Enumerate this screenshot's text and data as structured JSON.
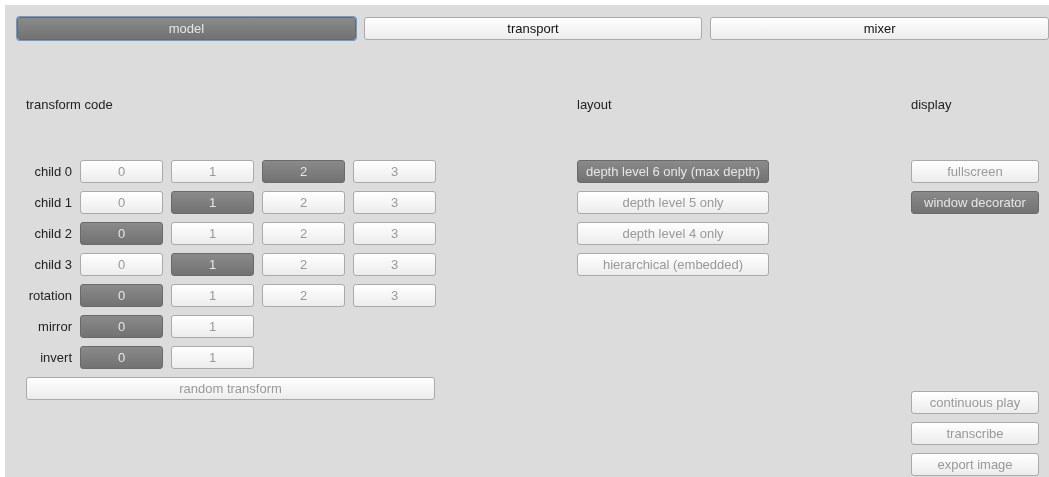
{
  "tabs": [
    {
      "label": "model",
      "selected": true
    },
    {
      "label": "transport",
      "selected": false
    },
    {
      "label": "mixer",
      "selected": false
    }
  ],
  "transform_code": {
    "title": "transform code",
    "rows": [
      {
        "label": "child 0",
        "options": [
          {
            "label": "0",
            "selected": false
          },
          {
            "label": "1",
            "selected": false
          },
          {
            "label": "2",
            "selected": true
          },
          {
            "label": "3",
            "selected": false
          }
        ]
      },
      {
        "label": "child 1",
        "options": [
          {
            "label": "0",
            "selected": false
          },
          {
            "label": "1",
            "selected": true
          },
          {
            "label": "2",
            "selected": false
          },
          {
            "label": "3",
            "selected": false
          }
        ]
      },
      {
        "label": "child 2",
        "options": [
          {
            "label": "0",
            "selected": true
          },
          {
            "label": "1",
            "selected": false
          },
          {
            "label": "2",
            "selected": false
          },
          {
            "label": "3",
            "selected": false
          }
        ]
      },
      {
        "label": "child 3",
        "options": [
          {
            "label": "0",
            "selected": false
          },
          {
            "label": "1",
            "selected": true
          },
          {
            "label": "2",
            "selected": false
          },
          {
            "label": "3",
            "selected": false
          }
        ]
      },
      {
        "label": "rotation",
        "options": [
          {
            "label": "0",
            "selected": true
          },
          {
            "label": "1",
            "selected": false
          },
          {
            "label": "2",
            "selected": false
          },
          {
            "label": "3",
            "selected": false
          }
        ]
      },
      {
        "label": "mirror",
        "options": [
          {
            "label": "0",
            "selected": true
          },
          {
            "label": "1",
            "selected": false
          }
        ]
      },
      {
        "label": "invert",
        "options": [
          {
            "label": "0",
            "selected": true
          },
          {
            "label": "1",
            "selected": false
          }
        ]
      }
    ],
    "random_button": "random transform"
  },
  "layout": {
    "title": "layout",
    "options": [
      {
        "label": "depth level 6 only (max depth)",
        "selected": true
      },
      {
        "label": "depth level 5 only",
        "selected": false
      },
      {
        "label": "depth level 4 only",
        "selected": false
      },
      {
        "label": "hierarchical (embedded)",
        "selected": false
      }
    ]
  },
  "display": {
    "title": "display",
    "toggles": [
      {
        "label": "fullscreen",
        "on": false
      },
      {
        "label": "window decorator",
        "on": true
      }
    ],
    "actions": [
      "continuous play",
      "transcribe",
      "export image"
    ]
  }
}
